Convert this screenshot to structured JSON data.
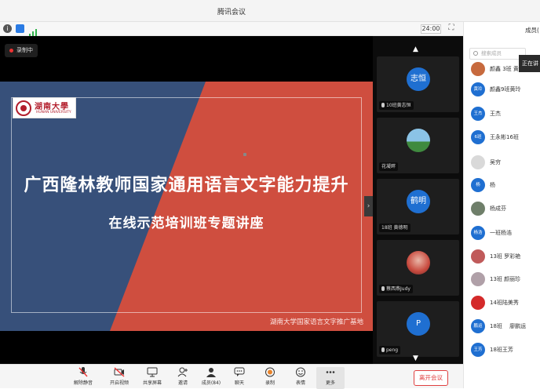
{
  "window": {
    "title": "腾讯会议"
  },
  "infobar": {
    "time": "24:00"
  },
  "stage": {
    "recording_label": "录制中",
    "slide": {
      "logo_cn": "湖南大學",
      "logo_en": "HUNAN UNIVERSITY",
      "headline": "广西隆林教师国家通用语言文字能力提升",
      "subline": "在线示范培训班专题讲座",
      "footer": "湖南大学国家语言文字推广基地",
      "colors": {
        "blue": "#37507a",
        "red": "#cf4e3f"
      }
    }
  },
  "gallery": {
    "tiles": [
      {
        "avatar_text": "志恒",
        "name": "10班黄志恒",
        "avatar_color": "#1f6fd1",
        "muted": true
      },
      {
        "avatar_text": "",
        "name": "花凝畔",
        "avatar_color": "#6aa0c9",
        "muted": false
      },
      {
        "avatar_text": "鹤明",
        "name": "18班 黄德明",
        "avatar_color": "#1f6fd1",
        "muted": false
      },
      {
        "avatar_text": "",
        "name": "蔡西燕Judy",
        "avatar_color": "#c84a3e",
        "muted": true
      },
      {
        "avatar_text": "P",
        "name": "peng",
        "avatar_color": "#1f6fd1",
        "muted": true
      }
    ]
  },
  "toolbar": {
    "buttons": [
      {
        "label": "解除静音",
        "icon": "mic-muted-icon"
      },
      {
        "label": "开启视频",
        "icon": "camera-off-icon"
      },
      {
        "label": "共享屏幕",
        "icon": "screen-share-icon"
      },
      {
        "label": "邀请",
        "icon": "invite-icon"
      },
      {
        "label": "成员(84)",
        "icon": "members-icon"
      },
      {
        "label": "聊天",
        "icon": "chat-icon"
      },
      {
        "label": "录制",
        "icon": "record-icon"
      },
      {
        "label": "表情",
        "icon": "emoji-icon"
      },
      {
        "label": "更多",
        "icon": "more-icon"
      }
    ],
    "leave_label": "离开会议"
  },
  "members": {
    "header": "成员(",
    "search_placeholder": "搜索成员",
    "tooltip": "正在讲",
    "list": [
      {
        "avatar": "",
        "name": "颜鑫 3班 黄",
        "color": "#c76a3e"
      },
      {
        "avatar": "黄玲",
        "name": "颜鑫9班黄玲",
        "color": "#1f6fd1"
      },
      {
        "avatar": "王杰",
        "name": "王杰",
        "color": "#1f6fd1"
      },
      {
        "avatar": "6班",
        "name": "王永彬16班",
        "color": "#1f6fd1"
      },
      {
        "avatar": "",
        "name": "吴穷",
        "color": "#d9d9d9"
      },
      {
        "avatar": "杨",
        "name": "杨",
        "color": "#1f6fd1"
      },
      {
        "avatar": "",
        "name": "杨成芬",
        "color": "#6f7f6a"
      },
      {
        "avatar": "杨浩",
        "name": "一班杨浩",
        "color": "#1f6fd1"
      },
      {
        "avatar": "",
        "name": "13班 罗彩艳",
        "color": "#c05a5a"
      },
      {
        "avatar": "",
        "name": "13班 颜丽珍",
        "color": "#b0a0a8"
      },
      {
        "avatar": "",
        "name": "14班陆美秀",
        "color": "#d42a2a"
      },
      {
        "avatar": "鹏运",
        "name": "18班 　廖鹏运",
        "color": "#1f6fd1"
      },
      {
        "avatar": "王芳",
        "name": "18班王芳",
        "color": "#1f6fd1"
      }
    ]
  }
}
